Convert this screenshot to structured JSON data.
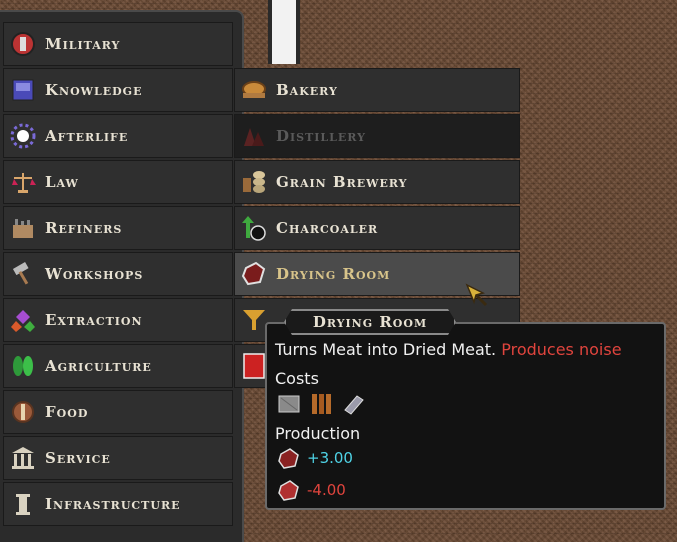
{
  "categories": [
    {
      "label": "Military",
      "icon": "shield-icon"
    },
    {
      "label": "Knowledge",
      "icon": "book-icon"
    },
    {
      "label": "Afterlife",
      "icon": "spirit-icon"
    },
    {
      "label": "Law",
      "icon": "scales-icon"
    },
    {
      "label": "Refiners",
      "icon": "factory-icon"
    },
    {
      "label": "Workshops",
      "icon": "hammer-icon"
    },
    {
      "label": "Extraction",
      "icon": "gems-icon"
    },
    {
      "label": "Agriculture",
      "icon": "leaves-icon"
    },
    {
      "label": "Food",
      "icon": "meat-icon"
    },
    {
      "label": "Service",
      "icon": "pillars-icon"
    },
    {
      "label": "Infrastructure",
      "icon": "column-icon"
    }
  ],
  "food_submenu": [
    {
      "label": "Bakery",
      "icon": "bread-icon"
    },
    {
      "label": "Distillery",
      "icon": "distillery-icon"
    },
    {
      "label": "Grain Brewery",
      "icon": "barrels-icon"
    },
    {
      "label": "Charcoaler",
      "icon": "charcoal-icon"
    },
    {
      "label": "Drying Room",
      "icon": "dried-meat-icon"
    }
  ],
  "tooltip": {
    "title": "Drying Room",
    "description": "Turns Meat into Dried Meat.",
    "warning": "Produces noise",
    "costs_label": "Costs",
    "production_label": "Production",
    "production": [
      {
        "value": "+3.00",
        "color": "#4fd3e6",
        "icon": "dried-meat-icon"
      },
      {
        "value": "-4.00",
        "color": "#e0443d",
        "icon": "meat-icon"
      }
    ]
  }
}
